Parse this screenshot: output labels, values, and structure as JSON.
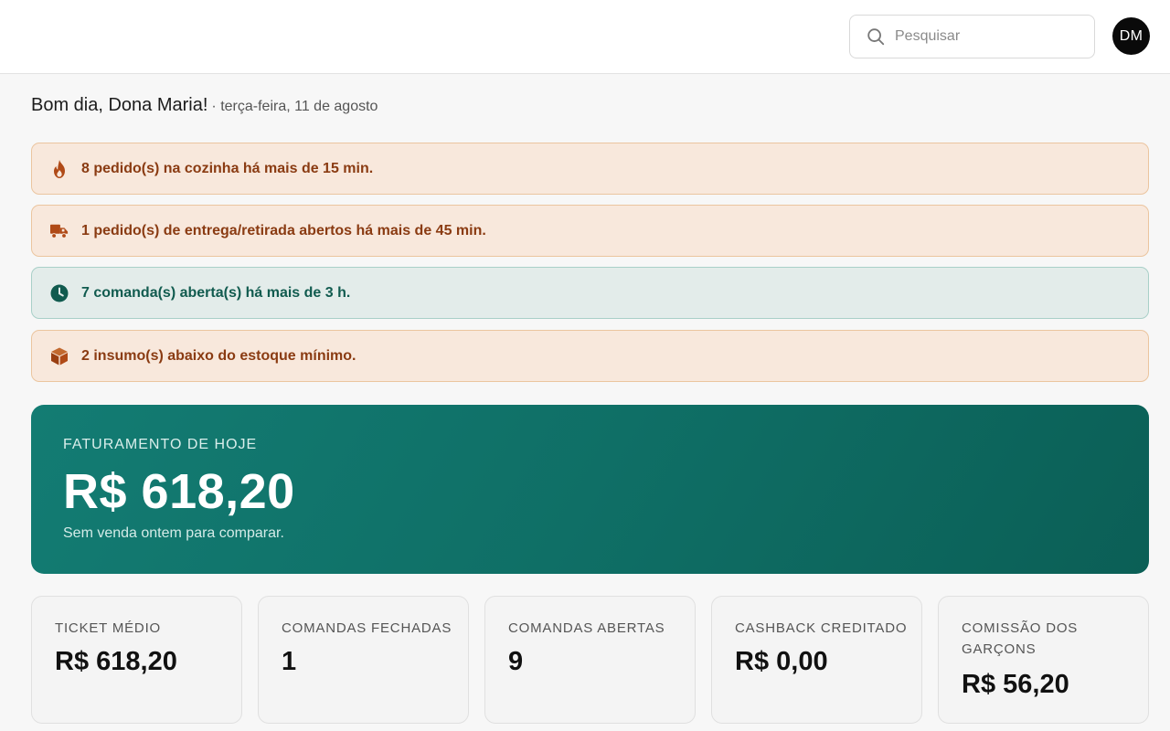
{
  "header": {
    "search_placeholder": "Pesquisar",
    "avatar_initials": "DM"
  },
  "greeting": {
    "hello": "Bom dia, Dona Maria!",
    "date": "· terça-feira, 11 de agosto"
  },
  "alerts": [
    {
      "icon": "fire-icon",
      "text": "8 pedido(s) na cozinha há mais de 15 min.",
      "type": "warning"
    },
    {
      "icon": "delivery-truck-icon",
      "text": "1 pedido(s) de entrega/retirada abertos há mais de 45 min.",
      "type": "warning"
    },
    {
      "icon": "clock-icon",
      "text": "7 comanda(s) aberta(s) há mais de 3 h.",
      "type": "info"
    },
    {
      "icon": "box-icon",
      "text": "2 insumo(s) abaixo do estoque mínimo.",
      "type": "warning"
    }
  ],
  "revenue": {
    "label": "FATURAMENTO DE HOJE",
    "value": "R$ 618,20",
    "comparison": "Sem venda ontem para comparar."
  },
  "stats": [
    {
      "label": "TICKET MÉDIO",
      "value": "R$ 618,20"
    },
    {
      "label": "COMANDAS FECHADAS",
      "value": "1"
    },
    {
      "label": "COMANDAS ABERTAS",
      "value": "9"
    },
    {
      "label": "CASHBACK CREDITADO",
      "value": "R$ 0,00"
    },
    {
      "label": "COMISSÃO DOS GARÇONS",
      "value": "R$ 56,20"
    }
  ],
  "colors": {
    "warning_bg": "#f8e8dc",
    "warning_text": "#8a3b12",
    "info_bg": "#e3ecea",
    "info_text": "#115b4f",
    "hero_bg": "#0f6f66"
  }
}
